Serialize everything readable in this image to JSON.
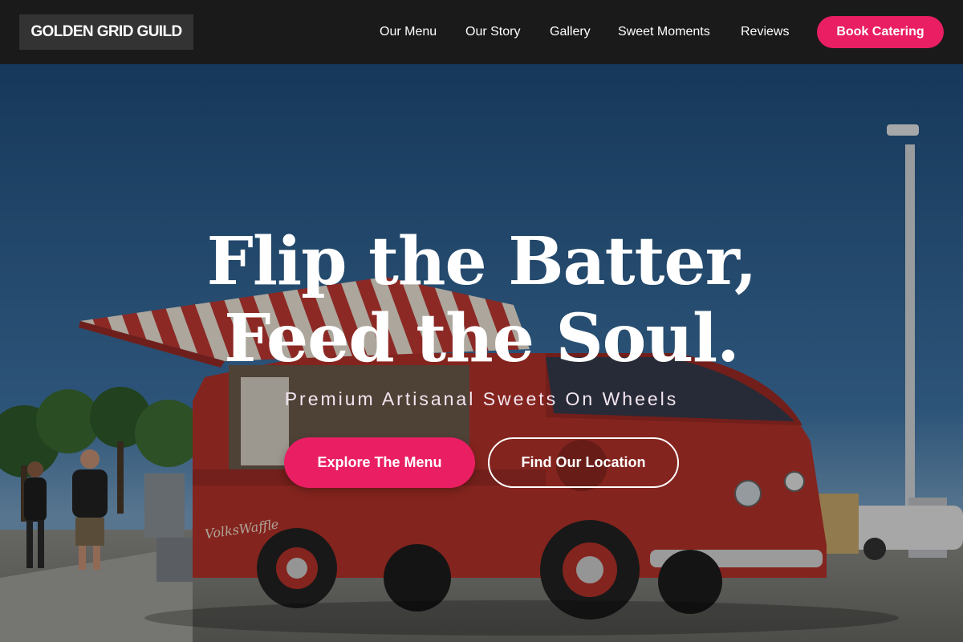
{
  "brand": {
    "name": "GOLDEN GRID GUILD"
  },
  "nav": {
    "items": [
      {
        "label": "Our Menu"
      },
      {
        "label": "Our Story"
      },
      {
        "label": "Gallery"
      },
      {
        "label": "Sweet Moments"
      },
      {
        "label": "Reviews"
      }
    ],
    "cta_label": "Book Catering"
  },
  "hero": {
    "title_line1": "Flip the Batter,",
    "title_line2": "Feed the Soul.",
    "subtitle": "Premium Artisanal Sweets On Wheels",
    "primary_button": "Explore The Menu",
    "secondary_button": "Find Our Location",
    "image_description_icon": "food-truck-photo"
  },
  "colors": {
    "accent": "#e91e63",
    "header_bg": "#1a1a1a",
    "logo_bg": "#333333",
    "sky": "#2f5f8f",
    "truck": "#b8322a"
  }
}
